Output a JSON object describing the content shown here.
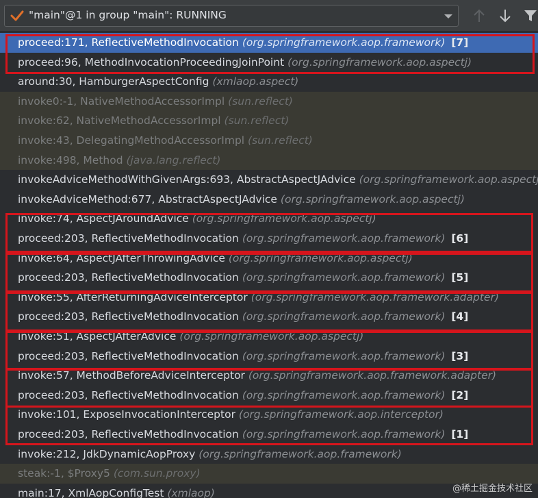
{
  "toolbar": {
    "thread_status": "\"main\"@1 in group \"main\": RUNNING",
    "icons": [
      "check-icon",
      "chevron-down-icon",
      "arrow-up-icon",
      "arrow-down-icon",
      "filter-icon"
    ]
  },
  "frames": [
    {
      "method": "proceed:171, ReflectiveMethodInvocation",
      "pkg": "(org.springframework.aop.framework)",
      "index": "[7]",
      "style": "selected"
    },
    {
      "method": "proceed:96, MethodInvocationProceedingJoinPoint",
      "pkg": "(org.springframework.aop.aspectj)",
      "index": "",
      "style": "normal"
    },
    {
      "method": "around:30, HamburgerAspectConfig",
      "pkg": "(xmlaop.aspect)",
      "index": "",
      "style": "normal"
    },
    {
      "method": "invoke0:-1, NativeMethodAccessorImpl",
      "pkg": "(sun.reflect)",
      "index": "",
      "style": "lib"
    },
    {
      "method": "invoke:62, NativeMethodAccessorImpl",
      "pkg": "(sun.reflect)",
      "index": "",
      "style": "lib"
    },
    {
      "method": "invoke:43, DelegatingMethodAccessorImpl",
      "pkg": "(sun.reflect)",
      "index": "",
      "style": "lib"
    },
    {
      "method": "invoke:498, Method",
      "pkg": "(java.lang.reflect)",
      "index": "",
      "style": "lib"
    },
    {
      "method": "invokeAdviceMethodWithGivenArgs:693, AbstractAspectJAdvice",
      "pkg": "(org.springframework.aop.aspectj)",
      "index": "",
      "style": "normal"
    },
    {
      "method": "invokeAdviceMethod:677, AbstractAspectJAdvice",
      "pkg": "(org.springframework.aop.aspectj)",
      "index": "",
      "style": "normal"
    },
    {
      "method": "invoke:74, AspectJAroundAdvice",
      "pkg": "(org.springframework.aop.aspectj)",
      "index": "",
      "style": "normal"
    },
    {
      "method": "proceed:203, ReflectiveMethodInvocation",
      "pkg": "(org.springframework.aop.framework)",
      "index": "[6]",
      "style": "normal"
    },
    {
      "method": "invoke:64, AspectJAfterThrowingAdvice",
      "pkg": "(org.springframework.aop.aspectj)",
      "index": "",
      "style": "normal"
    },
    {
      "method": "proceed:203, ReflectiveMethodInvocation",
      "pkg": "(org.springframework.aop.framework)",
      "index": "[5]",
      "style": "normal"
    },
    {
      "method": "invoke:55, AfterReturningAdviceInterceptor",
      "pkg": "(org.springframework.aop.framework.adapter)",
      "index": "",
      "style": "normal"
    },
    {
      "method": "proceed:203, ReflectiveMethodInvocation",
      "pkg": "(org.springframework.aop.framework)",
      "index": "[4]",
      "style": "normal"
    },
    {
      "method": "invoke:51, AspectJAfterAdvice",
      "pkg": "(org.springframework.aop.aspectj)",
      "index": "",
      "style": "normal"
    },
    {
      "method": "proceed:203, ReflectiveMethodInvocation",
      "pkg": "(org.springframework.aop.framework)",
      "index": "[3]",
      "style": "normal"
    },
    {
      "method": "invoke:57, MethodBeforeAdviceInterceptor",
      "pkg": "(org.springframework.aop.framework.adapter)",
      "index": "",
      "style": "normal"
    },
    {
      "method": "proceed:203, ReflectiveMethodInvocation",
      "pkg": "(org.springframework.aop.framework)",
      "index": "[2]",
      "style": "normal"
    },
    {
      "method": "invoke:101, ExposeInvocationInterceptor",
      "pkg": "(org.springframework.aop.interceptor)",
      "index": "",
      "style": "normal"
    },
    {
      "method": "proceed:203, ReflectiveMethodInvocation",
      "pkg": "(org.springframework.aop.framework)",
      "index": "[1]",
      "style": "normal"
    },
    {
      "method": "invoke:212, JdkDynamicAopProxy",
      "pkg": "(org.springframework.aop.framework)",
      "index": "",
      "style": "normal"
    },
    {
      "method": "steak:-1, $Proxy5",
      "pkg": "(com.sun.proxy)",
      "index": "",
      "style": "lib"
    },
    {
      "method": "main:17, XmlAopConfigTest",
      "pkg": "(xmlaop)",
      "index": "",
      "style": "normal"
    }
  ],
  "highlight_color": "#d6151c",
  "watermark": "@稀土掘金技术社区"
}
